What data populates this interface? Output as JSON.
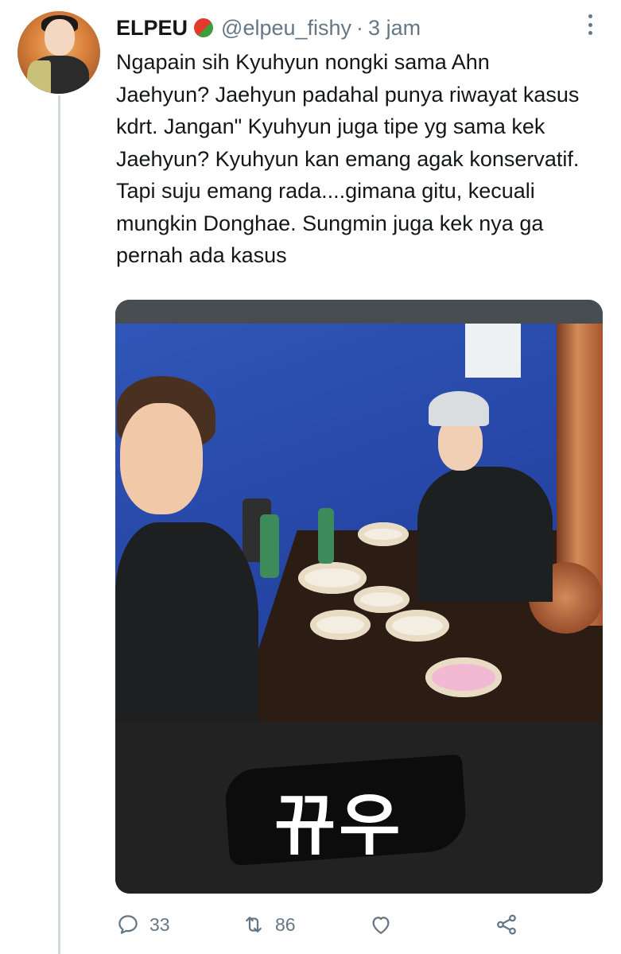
{
  "tweet": {
    "display_name": "ELPEU",
    "handle": "@elpeu_fishy",
    "separator": "·",
    "time": "3 jam",
    "text": "Ngapain sih Kyuhyun nongki sama Ahn Jaehyun? Jaehyun padahal punya riwayat kasus kdrt. Jangan\" Kyuhyun juga tipe yg sama kek Jaehyun? Kyuhyun kan emang agak konservatif. Tapi suju emang rada....gimana gitu, kecuali mungkin Donghae. Sungmin juga kek nya ga pernah ada kasus",
    "name_emoji": "mango-emoji",
    "media": {
      "overlay_text": "뀨우",
      "description_icon": "photo-image"
    },
    "actions": {
      "reply_icon": "reply-icon",
      "reply_count": "33",
      "retweet_icon": "retweet-icon",
      "retweet_count": "86",
      "like_icon": "heart-icon",
      "share_icon": "share-icon"
    }
  },
  "colors": {
    "text": "#14171a",
    "secondary": "#657786",
    "thread_line": "#cfd9de"
  }
}
